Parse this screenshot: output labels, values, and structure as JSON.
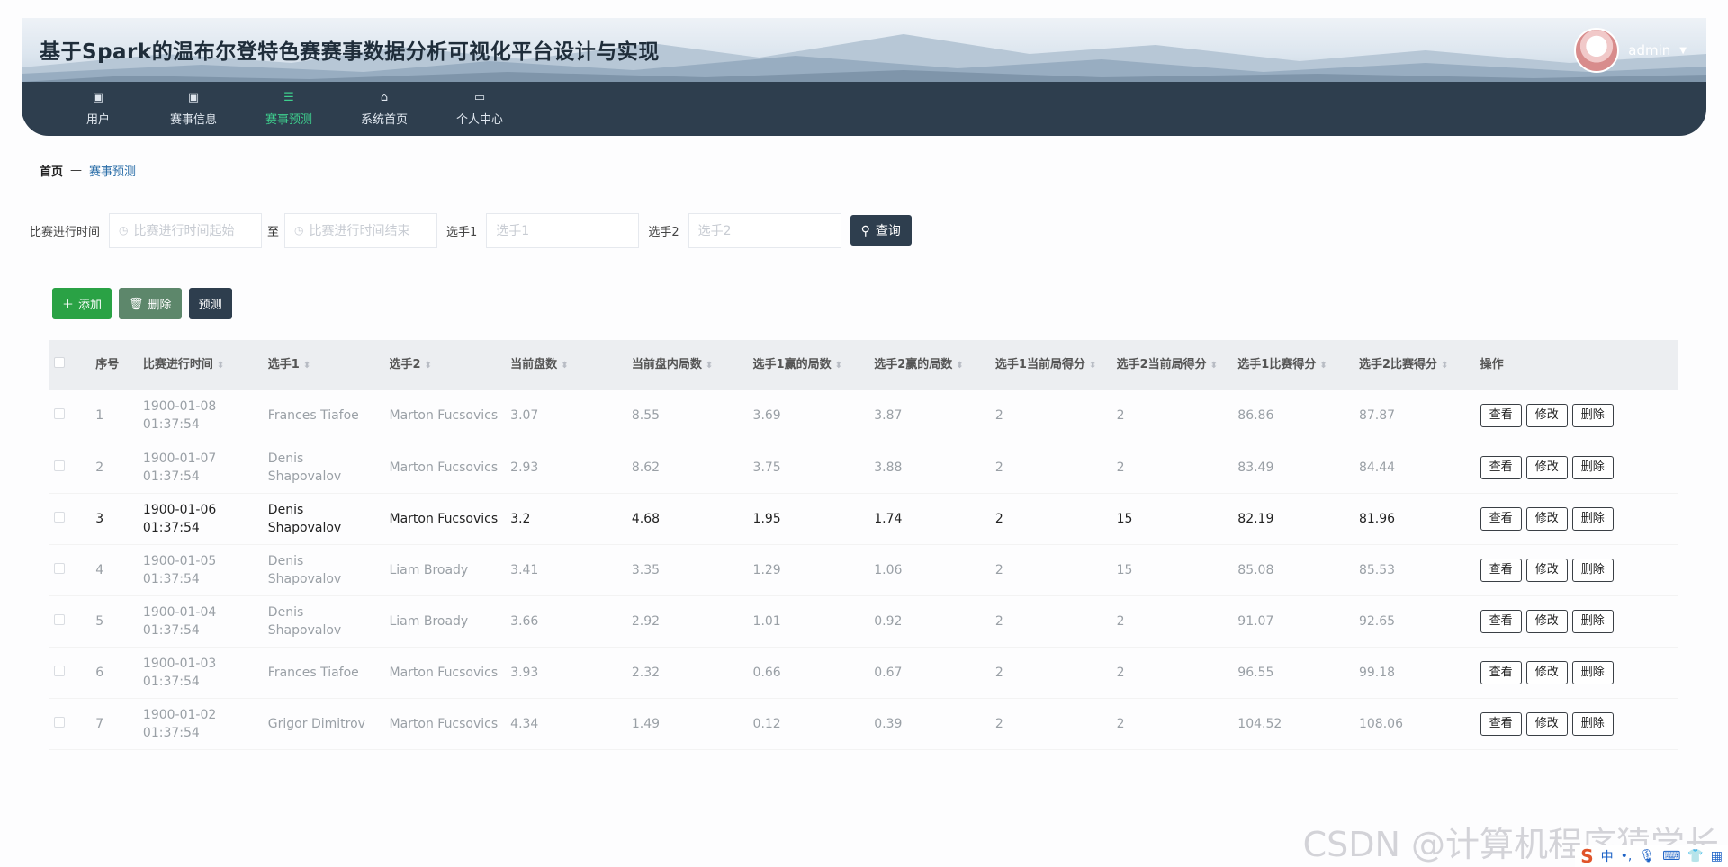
{
  "site": {
    "title": "基于Spark的温布尔登特色赛赛事数据分析可视化平台设计与实现"
  },
  "user": {
    "name": "admin"
  },
  "nav": [
    {
      "label": "用户",
      "icon": "▣",
      "active": false
    },
    {
      "label": "赛事信息",
      "icon": "▣",
      "active": false
    },
    {
      "label": "赛事预测",
      "icon": "☰",
      "active": true
    },
    {
      "label": "系统首页",
      "icon": "⌂",
      "active": false
    },
    {
      "label": "个人中心",
      "icon": "▭",
      "active": false
    }
  ],
  "breadcrumb": {
    "home": "首页",
    "sep": "—",
    "current": "赛事预测"
  },
  "search": {
    "time_label": "比赛进行时间",
    "start_placeholder": "比赛进行时间起始",
    "range_sep": "至",
    "end_placeholder": "比赛进行时间结束",
    "p1_label": "选手1",
    "p1_placeholder": "选手1",
    "p2_label": "选手2",
    "p2_placeholder": "选手2",
    "query_label": "查询"
  },
  "actions": {
    "add": "添加",
    "delete": "删除",
    "predict": "预测"
  },
  "table": {
    "headers": [
      "序号",
      "比赛进行时间",
      "选手1",
      "选手2",
      "当前盘数",
      "当前盘内局数",
      "选手1赢的局数",
      "选手2赢的局数",
      "选手1当前局得分",
      "选手2当前局得分",
      "选手1比赛得分",
      "选手2比赛得分",
      "操作"
    ],
    "op": {
      "view": "查看",
      "edit": "修改",
      "del": "删除"
    },
    "rows": [
      [
        "1",
        "1900-01-08 01:37:54",
        "Frances Tiafoe",
        "Marton Fucsovics",
        "3.07",
        "8.55",
        "3.69",
        "3.87",
        "2",
        "2",
        "86.86",
        "87.87"
      ],
      [
        "2",
        "1900-01-07 01:37:54",
        "Denis Shapovalov",
        "Marton Fucsovics",
        "2.93",
        "8.62",
        "3.75",
        "3.88",
        "2",
        "2",
        "83.49",
        "84.44"
      ],
      [
        "3",
        "1900-01-06 01:37:54",
        "Denis Shapovalov",
        "Marton Fucsovics",
        "3.2",
        "4.68",
        "1.95",
        "1.74",
        "2",
        "15",
        "82.19",
        "81.96"
      ],
      [
        "4",
        "1900-01-05 01:37:54",
        "Denis Shapovalov",
        "Liam Broady",
        "3.41",
        "3.35",
        "1.29",
        "1.06",
        "2",
        "15",
        "85.08",
        "85.53"
      ],
      [
        "5",
        "1900-01-04 01:37:54",
        "Denis Shapovalov",
        "Liam Broady",
        "3.66",
        "2.92",
        "1.01",
        "0.92",
        "2",
        "2",
        "91.07",
        "92.65"
      ],
      [
        "6",
        "1900-01-03 01:37:54",
        "Frances Tiafoe",
        "Marton Fucsovics",
        "3.93",
        "2.32",
        "0.66",
        "0.67",
        "2",
        "2",
        "96.55",
        "99.18"
      ],
      [
        "7",
        "1900-01-02 01:37:54",
        "Grigor Dimitrov",
        "Marton Fucsovics",
        "4.34",
        "1.49",
        "0.12",
        "0.39",
        "2",
        "2",
        "104.52",
        "108.06"
      ]
    ]
  },
  "watermark": "CSDN @计算机程序猿学长",
  "ime": {
    "lang": "中"
  }
}
